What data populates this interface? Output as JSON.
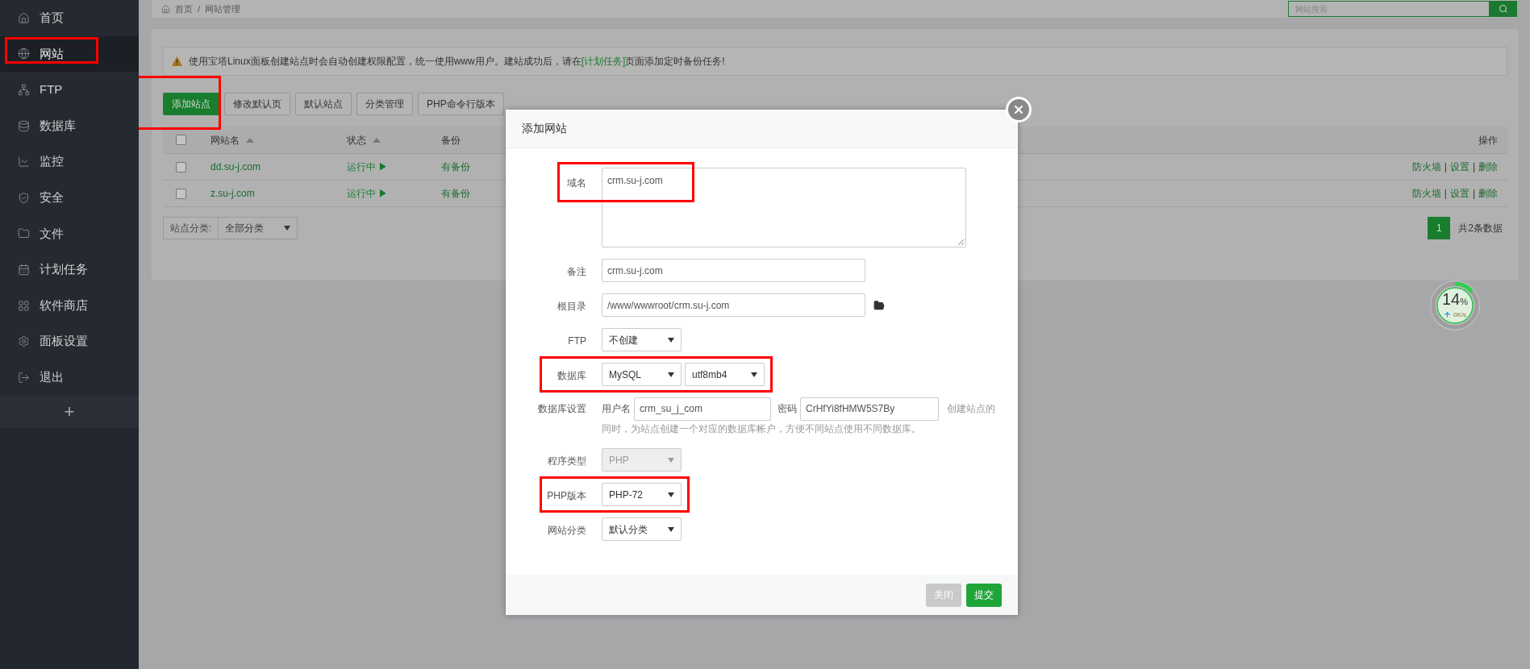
{
  "sidebar": {
    "items": [
      {
        "label": "首页",
        "selected": false,
        "highlighted": false
      },
      {
        "label": "网站",
        "selected": true,
        "highlighted": true
      },
      {
        "label": "FTP",
        "selected": false,
        "highlighted": false
      },
      {
        "label": "数据库",
        "selected": false,
        "highlighted": false
      },
      {
        "label": "监控",
        "selected": false,
        "highlighted": false
      },
      {
        "label": "安全",
        "selected": false,
        "highlighted": false
      },
      {
        "label": "文件",
        "selected": false,
        "highlighted": false
      },
      {
        "label": "计划任务",
        "selected": false,
        "highlighted": false
      },
      {
        "label": "软件商店",
        "selected": false,
        "highlighted": false
      },
      {
        "label": "面板设置",
        "selected": false,
        "highlighted": false
      },
      {
        "label": "退出",
        "selected": false,
        "highlighted": false
      }
    ],
    "add_label": "+"
  },
  "breadcrumb": [
    "首页",
    "网站管理"
  ],
  "breadcrumb_separator": "/",
  "search": {
    "placeholder": "网站搜索"
  },
  "alert": {
    "before": "使用宝塔Linux面板创建站点时会自动创建权限配置，统一使用www用户。建站成功后，请在",
    "link": "[计划任务]",
    "after": "页面添加定时备份任务!"
  },
  "toolbar": [
    {
      "label": "添加站点",
      "kind": "primary",
      "highlighted": true
    },
    {
      "label": "修改默认页",
      "kind": "default",
      "highlighted": false
    },
    {
      "label": "默认站点",
      "kind": "default",
      "highlighted": false
    },
    {
      "label": "分类管理",
      "kind": "default",
      "highlighted": false
    },
    {
      "label": "PHP命令行版本",
      "kind": "default",
      "highlighted": false
    }
  ],
  "table": {
    "columns": [
      {
        "label": "网站名",
        "sortable": true
      },
      {
        "label": "状态",
        "sortable": true
      },
      {
        "label": "备份",
        "sortable": false
      },
      {
        "label": "操作",
        "sortable": false
      }
    ],
    "action_separator": "|",
    "rows": [
      {
        "checked": false,
        "name": "dd.su-j.com",
        "status": "运行中 ▶",
        "backup": "有备份",
        "actions": [
          "防火墙",
          "设置",
          "删除"
        ]
      },
      {
        "checked": false,
        "name": "z.su-j.com",
        "status": "运行中 ▶",
        "backup": "有备份",
        "actions": [
          "防火墙",
          "设置",
          "删除"
        ]
      }
    ]
  },
  "footer": {
    "category_label": "站点分类:",
    "category_value": "全部分类",
    "pages": [
      {
        "label": "1",
        "selected": true
      }
    ],
    "total": "共2条数据"
  },
  "speed": {
    "percent": "14",
    "unit": "%",
    "rate": "0K/s",
    "level": 0.14
  },
  "modal": {
    "title": "添加网站",
    "fields": [
      {
        "kind": "textarea",
        "label": "域名",
        "value": "crm.su-j.com",
        "highlighted": true
      },
      {
        "kind": "text",
        "label": "备注",
        "value": "crm.su-j.com",
        "highlighted": false
      },
      {
        "kind": "path",
        "label": "根目录",
        "value": "/www/wwwroot/crm.su-j.com",
        "highlighted": false
      },
      {
        "kind": "select",
        "label": "FTP",
        "values": [
          "不创建"
        ],
        "disabled": false,
        "highlighted": false
      },
      {
        "kind": "select",
        "label": "数据库",
        "values": [
          "MySQL",
          "utf8mb4"
        ],
        "disabled": false,
        "highlighted": true
      },
      {
        "kind": "dbsettings",
        "label": "数据库设置",
        "user_label": "用户名",
        "user": "crm_su_j_com",
        "password_label": "密码",
        "password": "CrHfYi8fHMW5S7By",
        "hint_lines": [
          "创建站点的",
          "同时，为站点创建一个对应的数据库帐户，方便不同站点使用不同数据库。"
        ],
        "highlighted": false
      },
      {
        "kind": "select",
        "label": "程序类型",
        "values": [
          "PHP"
        ],
        "disabled": true,
        "highlighted": false
      },
      {
        "kind": "select",
        "label": "PHP版本",
        "values": [
          "PHP-72"
        ],
        "disabled": false,
        "highlighted": true
      },
      {
        "kind": "select",
        "label": "网站分类",
        "values": [
          "默认分类"
        ],
        "disabled": false,
        "highlighted": false
      }
    ],
    "buttons": [
      {
        "label": "关闭",
        "kind": "secondary"
      },
      {
        "label": "提交",
        "kind": "primary"
      }
    ]
  }
}
